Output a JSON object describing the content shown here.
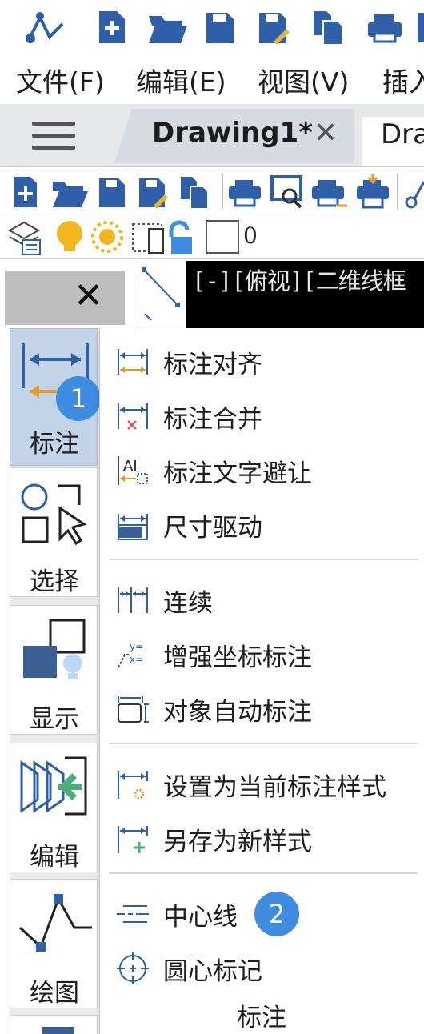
{
  "menubar": {
    "items": [
      {
        "label": "文件(F)"
      },
      {
        "label": "编辑(E)"
      },
      {
        "label": "视图(V)"
      },
      {
        "label": "插入"
      }
    ]
  },
  "tabs": {
    "active_title": "Drawing1*",
    "close_glyph": "✕",
    "next_title": "Dra"
  },
  "layer_toolbar": {
    "layer_value": "0"
  },
  "panel": {
    "close_glyph": "✕"
  },
  "viewport": {
    "label": "[-][俯视][二维线框"
  },
  "ribbon": {
    "items": [
      {
        "label": "标注",
        "icon": "dimension-icon",
        "active": true
      },
      {
        "label": "选择",
        "icon": "select-icon"
      },
      {
        "label": "显示",
        "icon": "display-icon"
      },
      {
        "label": "编辑",
        "icon": "edit-icon"
      },
      {
        "label": "绘图",
        "icon": "draw-icon"
      }
    ]
  },
  "dropdown": {
    "items": [
      {
        "label": "标注对齐",
        "icon": "dim-align-icon"
      },
      {
        "label": "标注合并",
        "icon": "dim-merge-icon"
      },
      {
        "label": "标注文字避让",
        "icon": "dim-text-avoid-icon"
      },
      {
        "label": "尺寸驱动",
        "icon": "dim-drive-icon"
      },
      {
        "label": "连续",
        "icon": "dim-continue-icon"
      },
      {
        "label": "增强坐标标注",
        "icon": "dim-ordinate-icon"
      },
      {
        "label": "对象自动标注",
        "icon": "dim-auto-icon"
      },
      {
        "label": "设置为当前标注样式",
        "icon": "dim-set-current-icon"
      },
      {
        "label": "另存为新样式",
        "icon": "dim-save-style-icon"
      },
      {
        "label": "中心线",
        "icon": "centerline-icon"
      },
      {
        "label": "圆心标记",
        "icon": "center-mark-icon"
      }
    ],
    "footer": "标注"
  },
  "badges": {
    "first": "1",
    "second": "2"
  },
  "colors": {
    "accent": "#3f8de0",
    "icon_blue": "#2f5fa8",
    "icon_orange": "#e59a2b",
    "ribbon_active": "#c3d3e8"
  }
}
